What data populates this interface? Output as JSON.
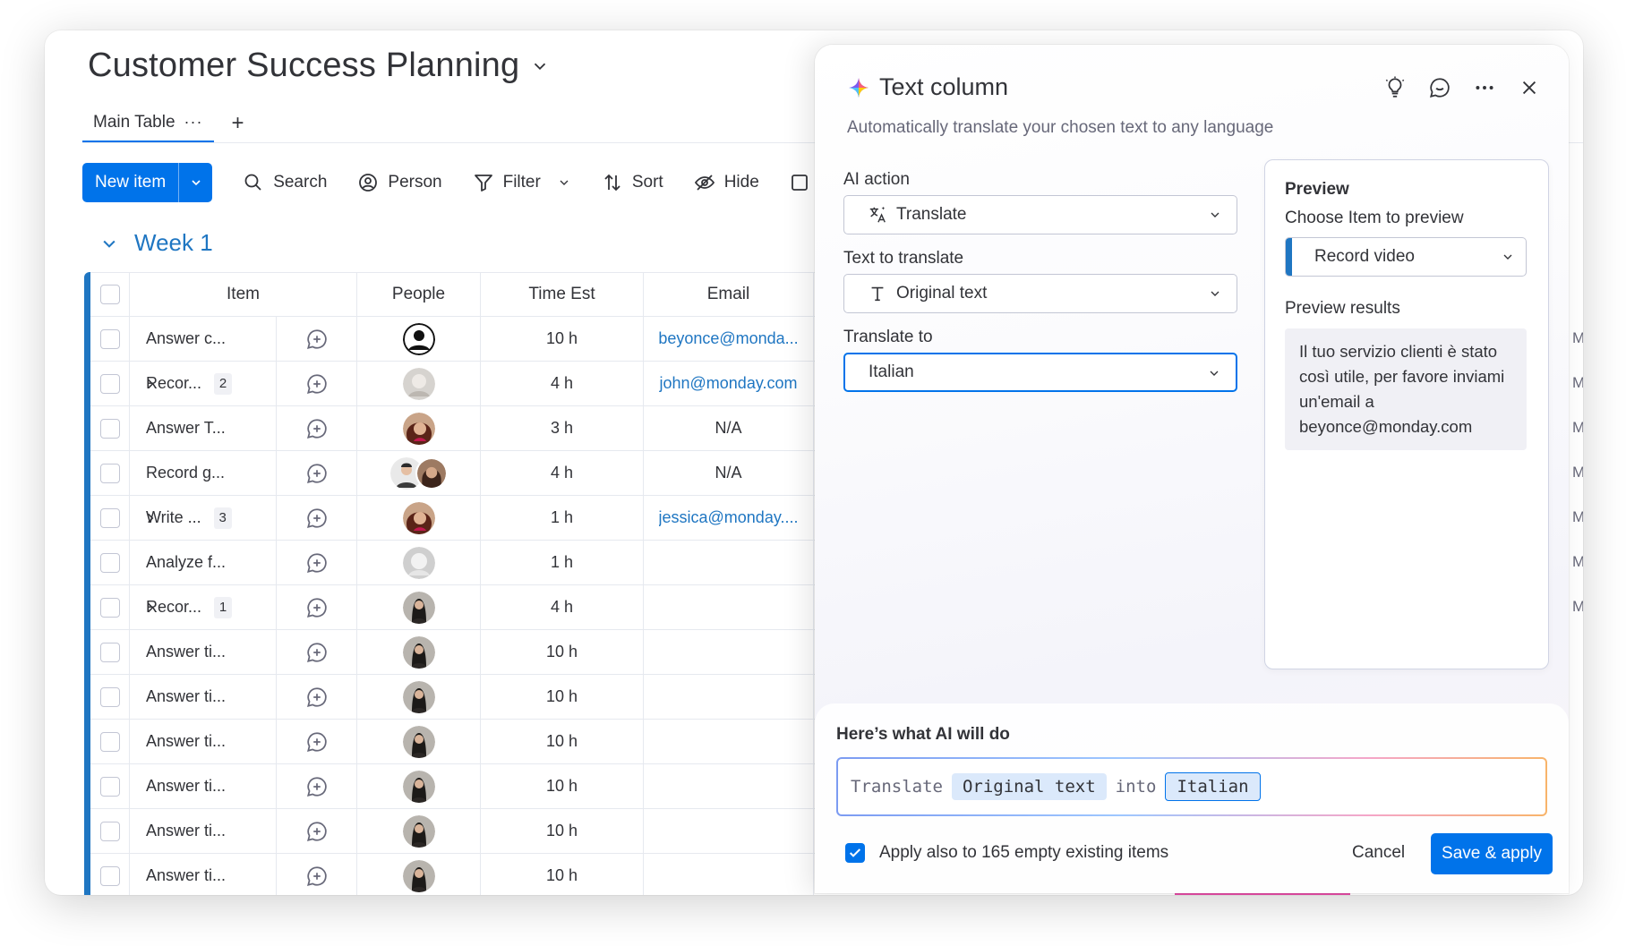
{
  "board": {
    "title": "Customer Success Planning",
    "tab": "Main Table",
    "tab_more": "···",
    "add_tab": "+",
    "toolbar": {
      "new_item": "New item",
      "search": "Search",
      "person": "Person",
      "filter": "Filter",
      "sort": "Sort",
      "hide": "Hide"
    },
    "group_title": "Week 1",
    "columns": [
      "Item",
      "People",
      "Time Est",
      "Email"
    ],
    "rows": [
      {
        "item": "Answer c...",
        "sub": "",
        "time": "10 h",
        "email": "beyonce@monda...",
        "email_link": true,
        "avatar": "outline"
      },
      {
        "item": "Recor...",
        "sub": "2",
        "time": "4 h",
        "email": "john@monday.com",
        "email_link": true,
        "avatar": "grey"
      },
      {
        "item": "Answer T...",
        "sub": "",
        "time": "3 h",
        "email": "N/A",
        "email_link": false,
        "avatar": "curly"
      },
      {
        "item": "Record g...",
        "sub": "",
        "time": "4 h",
        "email": "N/A",
        "email_link": false,
        "avatar": "pair"
      },
      {
        "item": "Write ...",
        "sub": "3",
        "time": "1 h",
        "email": "jessica@monday....",
        "email_link": true,
        "avatar": "curly"
      },
      {
        "item": "Analyze f...",
        "sub": "",
        "time": "1 h",
        "email": "",
        "email_link": false,
        "avatar": "light"
      },
      {
        "item": "Recor...",
        "sub": "1",
        "time": "4 h",
        "email": "",
        "email_link": false,
        "avatar": "dark"
      },
      {
        "item": "Answer ti...",
        "sub": "",
        "time": "10 h",
        "email": "",
        "email_link": false,
        "avatar": "dark"
      },
      {
        "item": "Answer ti...",
        "sub": "",
        "time": "10 h",
        "email": "",
        "email_link": false,
        "avatar": "dark"
      },
      {
        "item": "Answer ti...",
        "sub": "",
        "time": "10 h",
        "email": "",
        "email_link": false,
        "avatar": "dark"
      },
      {
        "item": "Answer ti...",
        "sub": "",
        "time": "10 h",
        "email": "",
        "email_link": false,
        "avatar": "dark"
      },
      {
        "item": "Answer ti...",
        "sub": "",
        "time": "10 h",
        "email": "",
        "email_link": false,
        "avatar": "dark"
      },
      {
        "item": "Answer ti...",
        "sub": "",
        "time": "10 h",
        "email": "",
        "email_link": false,
        "avatar": "dark"
      }
    ],
    "right_edge_letter": "M"
  },
  "panel": {
    "title": "Text column",
    "subtitle": "Automatically translate your chosen text to any language",
    "ai_action_label": "AI action",
    "ai_action_value": "Translate",
    "text_to_translate_label": "Text to translate",
    "text_to_translate_value": "Original text",
    "translate_to_label": "Translate to",
    "translate_to_value": "Italian",
    "preview": {
      "title": "Preview",
      "choose_label": "Choose Item to preview",
      "choose_value": "Record video",
      "results_label": "Preview results",
      "results_text": "Il tuo servizio clienti è stato così utile, per favore inviami un'email a beyonce@monday.com"
    },
    "ai_summary": {
      "heading": "Here’s what AI will do",
      "word_translate": "Translate",
      "chip_source": "Original text",
      "word_into": "into",
      "chip_target": "Italian"
    },
    "apply_label": "Apply also to 165 empty existing items",
    "apply_checked": true,
    "cancel": "Cancel",
    "save": "Save & apply"
  },
  "colors": {
    "primary": "#0073ea",
    "group": "#1f76c2",
    "link": "#1f76c2"
  }
}
